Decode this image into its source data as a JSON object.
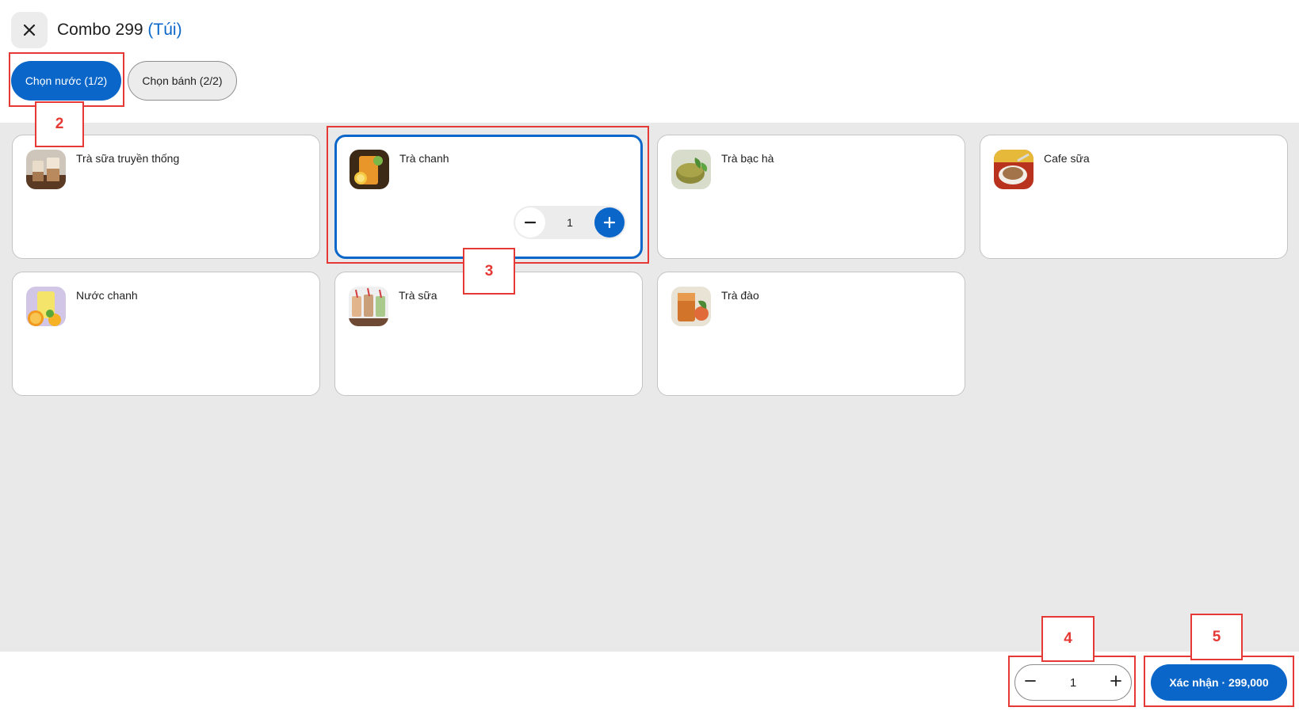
{
  "header": {
    "title": "Combo 299",
    "subtitle": "(Túi)"
  },
  "tabs": [
    {
      "label": "Chọn nước (1/2)",
      "active": true
    },
    {
      "label": "Chọn bánh (2/2)",
      "active": false
    }
  ],
  "items": [
    {
      "name": "Trà sữa truyền thống",
      "icon": "milk-tea-photo",
      "selected": false
    },
    {
      "name": "Trà chanh",
      "icon": "lemon-tea-photo",
      "selected": true,
      "quantity": "1"
    },
    {
      "name": "Trà bạc hà",
      "icon": "mint-tea-photo",
      "selected": false
    },
    {
      "name": "Cafe sữa",
      "icon": "milk-coffee-photo",
      "selected": false
    },
    {
      "name": "Nước chanh",
      "icon": "lemonade-photo",
      "selected": false
    },
    {
      "name": "Trà sữa",
      "icon": "bubble-tea-photo",
      "selected": false
    },
    {
      "name": "Trà đào",
      "icon": "peach-tea-photo",
      "selected": false
    }
  ],
  "footer": {
    "quantity": "1",
    "confirm_label": "Xác nhận · 299,000"
  },
  "annotations": [
    "2",
    "3",
    "4",
    "5"
  ],
  "colors": {
    "accent": "#0a66c8",
    "background": "#e9e9e9",
    "annotation": "#e53935"
  }
}
